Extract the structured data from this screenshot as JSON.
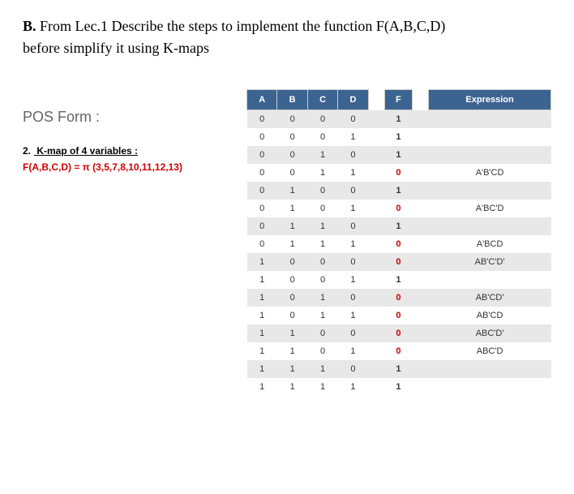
{
  "heading_prefix": "B.",
  "heading_text": " From Lec.1 Describe the steps to implement the function F(A,B,C,D)",
  "subheading": "before simplify it using K-maps",
  "pos_form": "POS Form :",
  "kmap_num": "2.",
  "kmap_label": "K-map of 4 variables :",
  "func_def": "F(A,B,C,D) = π (3,5,7,8,10,11,12,13)",
  "headers": {
    "A": "A",
    "B": "B",
    "C": "C",
    "D": "D",
    "F": "F",
    "Expression": "Expression"
  },
  "chart_data": {
    "type": "table",
    "columns": [
      "A",
      "B",
      "C",
      "D",
      "F",
      "Expression"
    ],
    "rows": [
      {
        "A": "0",
        "B": "0",
        "C": "0",
        "D": "0",
        "F": "1",
        "Expression": ""
      },
      {
        "A": "0",
        "B": "0",
        "C": "0",
        "D": "1",
        "F": "1",
        "Expression": ""
      },
      {
        "A": "0",
        "B": "0",
        "C": "1",
        "D": "0",
        "F": "1",
        "Expression": ""
      },
      {
        "A": "0",
        "B": "0",
        "C": "1",
        "D": "1",
        "F": "0",
        "Expression": "A'B'CD"
      },
      {
        "A": "0",
        "B": "1",
        "C": "0",
        "D": "0",
        "F": "1",
        "Expression": ""
      },
      {
        "A": "0",
        "B": "1",
        "C": "0",
        "D": "1",
        "F": "0",
        "Expression": "A'BC'D"
      },
      {
        "A": "0",
        "B": "1",
        "C": "1",
        "D": "0",
        "F": "1",
        "Expression": ""
      },
      {
        "A": "0",
        "B": "1",
        "C": "1",
        "D": "1",
        "F": "0",
        "Expression": "A'BCD"
      },
      {
        "A": "1",
        "B": "0",
        "C": "0",
        "D": "0",
        "F": "0",
        "Expression": "AB'C'D'"
      },
      {
        "A": "1",
        "B": "0",
        "C": "0",
        "D": "1",
        "F": "1",
        "Expression": ""
      },
      {
        "A": "1",
        "B": "0",
        "C": "1",
        "D": "0",
        "F": "0",
        "Expression": "AB'CD'"
      },
      {
        "A": "1",
        "B": "0",
        "C": "1",
        "D": "1",
        "F": "0",
        "Expression": "AB'CD"
      },
      {
        "A": "1",
        "B": "1",
        "C": "0",
        "D": "0",
        "F": "0",
        "Expression": "ABC'D'"
      },
      {
        "A": "1",
        "B": "1",
        "C": "0",
        "D": "1",
        "F": "0",
        "Expression": "ABC'D"
      },
      {
        "A": "1",
        "B": "1",
        "C": "1",
        "D": "0",
        "F": "1",
        "Expression": ""
      },
      {
        "A": "1",
        "B": "1",
        "C": "1",
        "D": "1",
        "F": "1",
        "Expression": ""
      }
    ]
  }
}
